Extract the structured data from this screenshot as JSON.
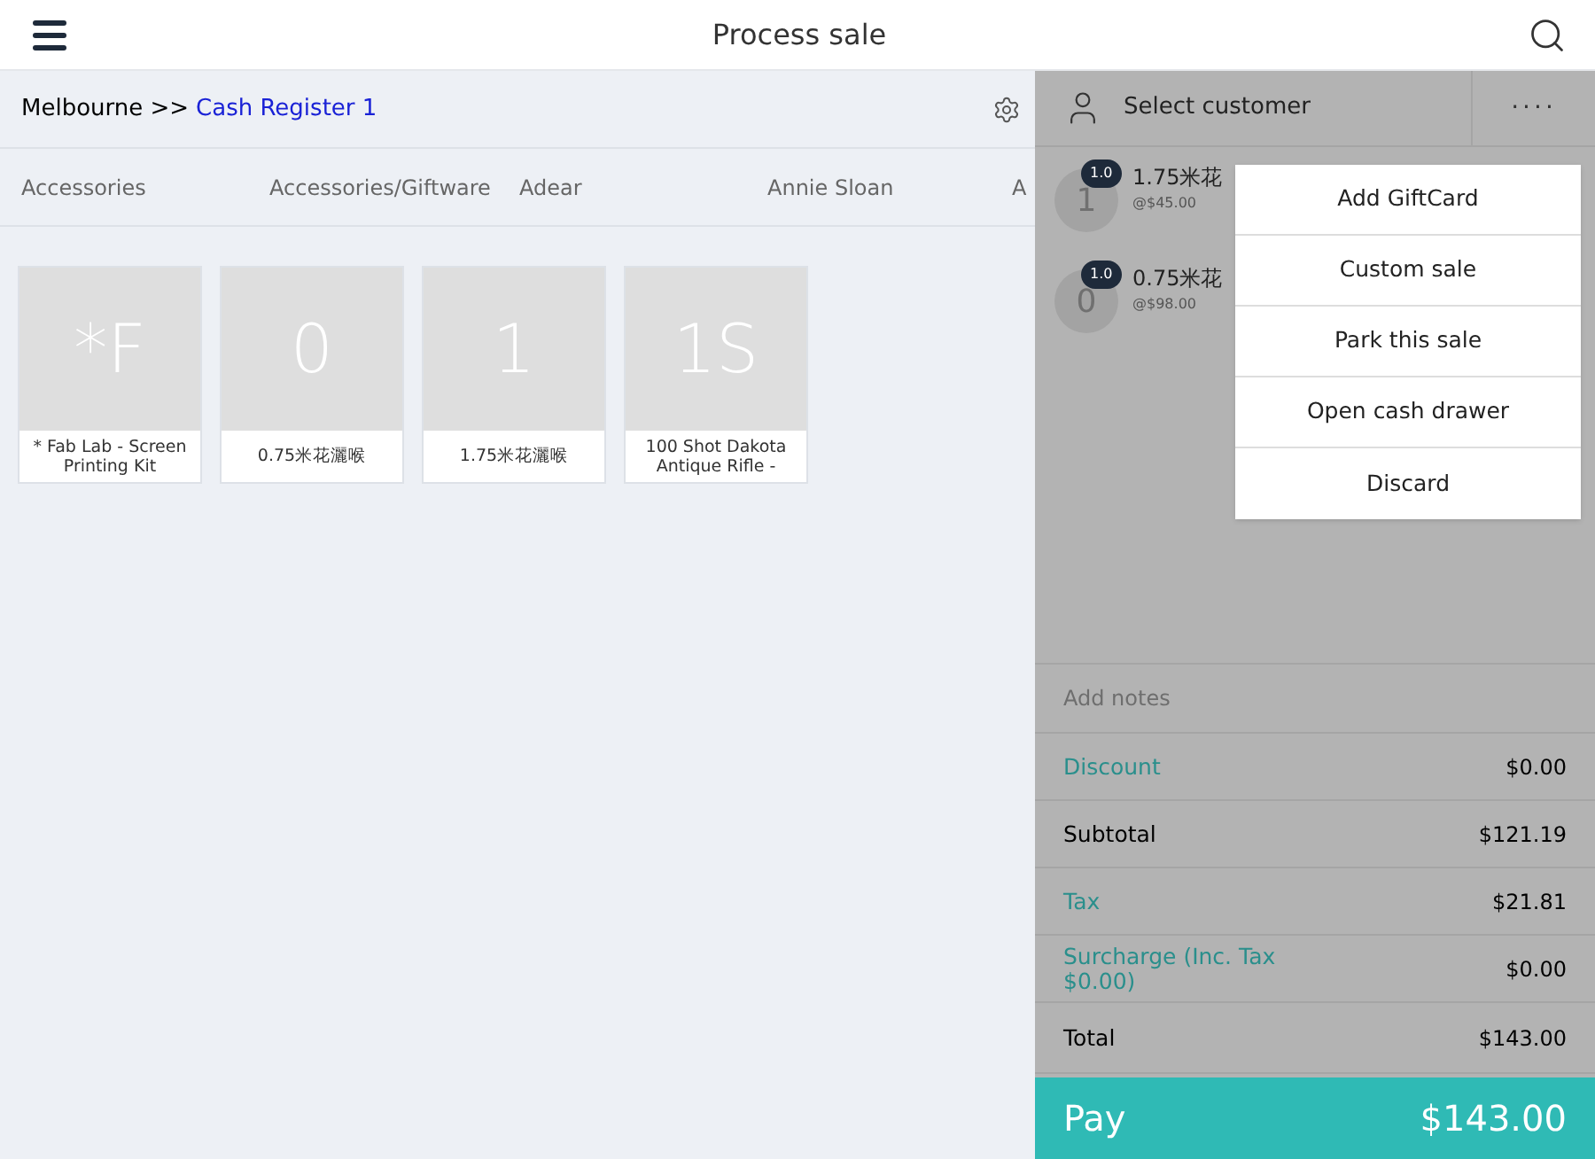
{
  "header": {
    "title": "Process sale"
  },
  "breadcrumb": {
    "location": "Melbourne >>",
    "register": "Cash Register 1"
  },
  "categories": [
    "Accessories",
    "Accessories/Giftware",
    "Adear",
    "Annie Sloan",
    "A"
  ],
  "products": [
    {
      "initials": "*F",
      "name": "* Fab Lab - Screen Printing Kit"
    },
    {
      "initials": "0",
      "name": "0.75米花灑喉"
    },
    {
      "initials": "1",
      "name": "1.75米花灑喉"
    },
    {
      "initials": "1S",
      "name": "100 Shot Dakota Antique Rifle -"
    }
  ],
  "customer": {
    "label": "Select customer",
    "more": "····"
  },
  "cart": [
    {
      "initial": "1",
      "qty": "1.0",
      "name": "1.75米花",
      "price": "@$45.00"
    },
    {
      "initial": "0",
      "qty": "1.0",
      "name": "0.75米花",
      "price": "@$98.00"
    }
  ],
  "menu": [
    "Add GiftCard",
    "Custom sale",
    "Park this sale",
    "Open cash drawer",
    "Discard"
  ],
  "notes": {
    "placeholder": "Add notes"
  },
  "summary": [
    {
      "kind": "link",
      "label": "Discount",
      "value": "$0.00"
    },
    {
      "kind": "plain",
      "label": "Subtotal",
      "value": "$121.19"
    },
    {
      "kind": "link",
      "label": "Tax",
      "value": "$21.81"
    },
    {
      "kind": "link",
      "label": "Surcharge (Inc. Tax $0.00)",
      "value": "$0.00"
    },
    {
      "kind": "plain",
      "label": "Total",
      "value": "$143.00"
    }
  ],
  "pay": {
    "label": "Pay",
    "amount": "$143.00"
  }
}
